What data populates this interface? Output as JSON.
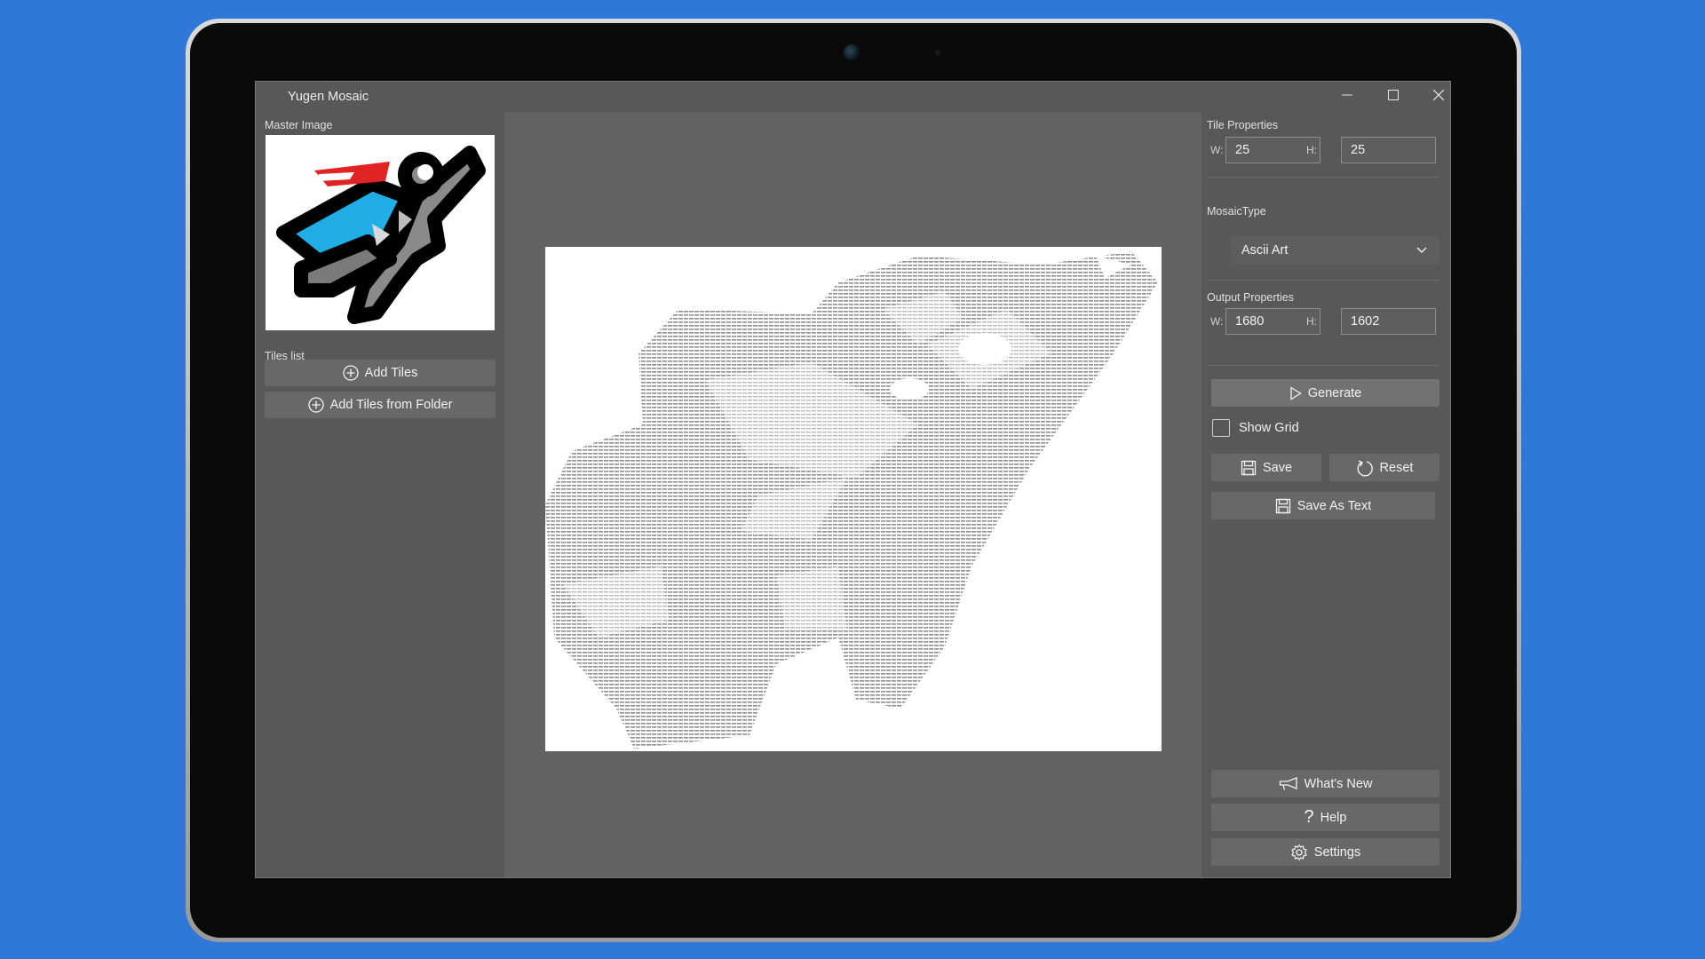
{
  "window": {
    "title": "Yugen Mosaic"
  },
  "left": {
    "master_label": "Master Image",
    "tiles_label": "Tiles list",
    "add_tiles": "Add Tiles",
    "add_tiles_folder": "Add Tiles from Folder"
  },
  "right": {
    "tile_properties_label": "Tile Properties",
    "tile_w_label": "W:",
    "tile_w": "25",
    "tile_h_label": "H:",
    "tile_h": "25",
    "mosaic_type_label": "MosaicType",
    "mosaic_type": "Ascii Art",
    "output_properties_label": "Output Properties",
    "out_w_label": "W:",
    "out_w": "1680",
    "out_h_label": "H:",
    "out_h": "1602",
    "generate": "Generate",
    "show_grid": "Show Grid",
    "show_grid_checked": false,
    "save": "Save",
    "reset": "Reset",
    "save_as_text": "Save As Text",
    "whats_new": "What's New",
    "help": "Help",
    "settings": "Settings"
  },
  "colors": {
    "background": "#2f78d8",
    "window": "#5f5f5f",
    "pane": "#585858"
  }
}
